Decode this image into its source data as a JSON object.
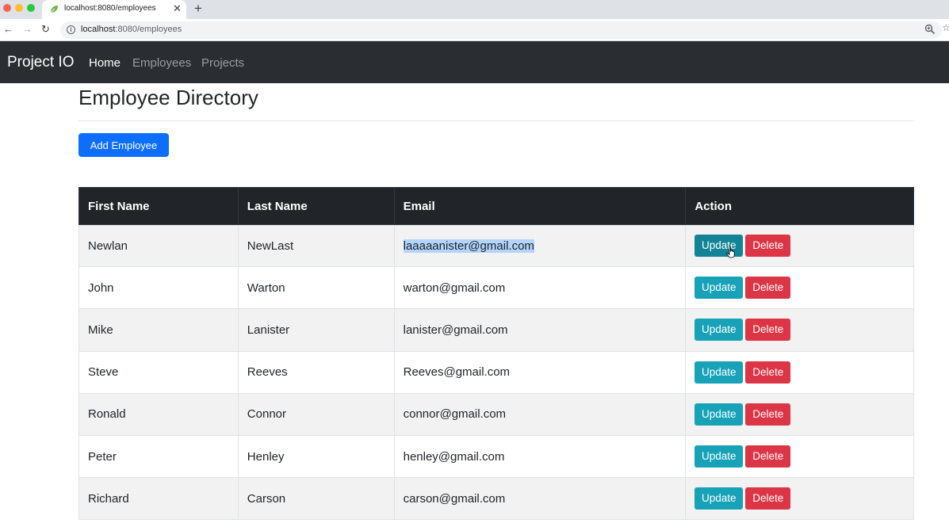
{
  "browser": {
    "tab_title": "localhost:8080/employees",
    "close_glyph": "✕",
    "new_tab_glyph": "+",
    "url_host": "localhost",
    "url_path": ":8080/employees",
    "back_glyph": "←",
    "forward_glyph": "→",
    "reload_glyph": "↻",
    "info_glyph": "i",
    "star_glyph": "☆",
    "icons": [
      "favicon-leaf-icon",
      "info-icon",
      "zoom-icon",
      "bookmark-star-icon"
    ]
  },
  "navbar": {
    "brand": "Project IO",
    "links": [
      {
        "label": "Home",
        "active": true
      },
      {
        "label": "Employees",
        "active": false
      },
      {
        "label": "Projects",
        "active": false
      }
    ]
  },
  "page": {
    "title": "Employee Directory",
    "add_button": "Add Employee"
  },
  "table": {
    "headers": [
      "First Name",
      "Last Name",
      "Email",
      "Action"
    ],
    "update_label": "Update",
    "delete_label": "Delete",
    "rows": [
      {
        "first": "Newlan",
        "last": "NewLast",
        "email": "laaaaanister@gmail.com",
        "email_selected": true
      },
      {
        "first": "John",
        "last": "Warton",
        "email": "warton@gmail.com"
      },
      {
        "first": "Mike",
        "last": "Lanister",
        "email": "lanister@gmail.com"
      },
      {
        "first": "Steve",
        "last": "Reeves",
        "email": "Reeves@gmail.com"
      },
      {
        "first": "Ronald",
        "last": "Connor",
        "email": "connor@gmail.com"
      },
      {
        "first": "Peter",
        "last": "Henley",
        "email": "henley@gmail.com"
      },
      {
        "first": "Richard",
        "last": "Carson",
        "email": "carson@gmail.com"
      }
    ]
  },
  "colors": {
    "navbar_bg": "#2a2e32",
    "primary": "#0d6efd",
    "info": "#17a2b8",
    "danger": "#dc3545",
    "table_head": "#212529",
    "selection": "#b3d4fc"
  }
}
